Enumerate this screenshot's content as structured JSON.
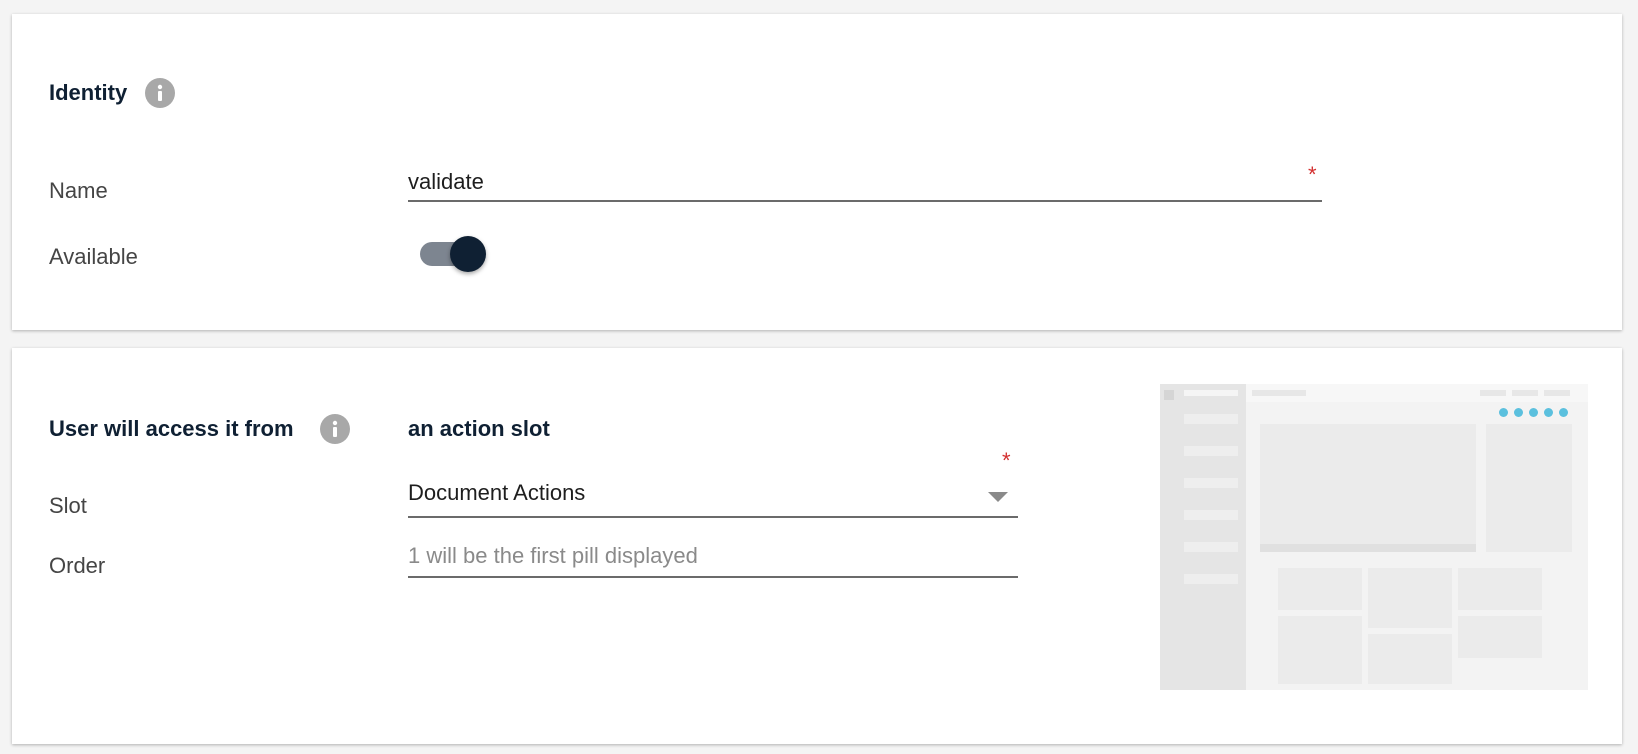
{
  "identity": {
    "title": "Identity",
    "info_icon": "info-icon",
    "name_label": "Name",
    "name_value": "validate",
    "name_required_mark": "*",
    "available_label": "Available",
    "available_on": true
  },
  "access": {
    "title": "User will access it from",
    "info_icon": "info-icon",
    "slot_type": "an action slot",
    "slot_label": "Slot",
    "slot_value": "Document Actions",
    "slot_required_mark": "*",
    "order_label": "Order",
    "order_value": "",
    "order_placeholder": "1 will be the first pill displayed",
    "preview_image": "action-slot-preview-illustration",
    "preview_highlight_color": "#5bc0de"
  },
  "colors": {
    "accent": "#0f2033",
    "required": "#d32f2f",
    "toggle_track": "#7d8590"
  }
}
